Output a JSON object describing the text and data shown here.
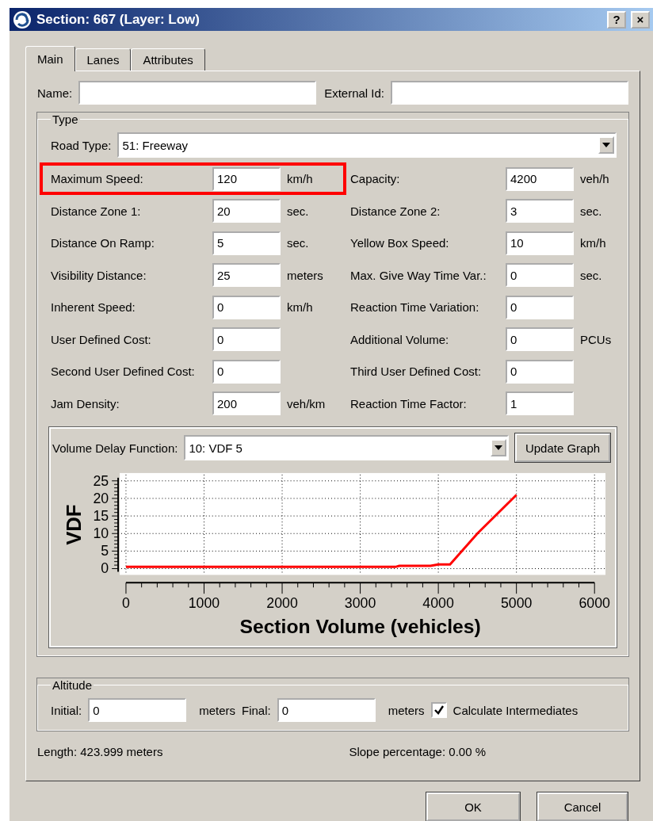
{
  "window": {
    "title": "Section: 667 (Layer: Low)",
    "buttons": [
      "?",
      "×"
    ]
  },
  "tabs": [
    {
      "label": "Main",
      "selected": true
    },
    {
      "label": "Lanes",
      "selected": false
    },
    {
      "label": "Attributes",
      "selected": false
    }
  ],
  "name_field": {
    "label": "Name:"
  },
  "external_id_field": {
    "label": "External Id:"
  },
  "type_group": {
    "title": "Type",
    "road_type": {
      "label": "Road Type:",
      "value": "51: Freeway"
    },
    "rows": [
      {
        "left": {
          "label": "Maximum Speed:",
          "value": "120",
          "unit": "km/h",
          "highlighted": true
        },
        "right": {
          "label": "Capacity:",
          "value": "4200",
          "unit": "veh/h"
        }
      },
      {
        "left": {
          "label": "Distance Zone 1:",
          "value": "20",
          "unit": "sec."
        },
        "right": {
          "label": "Distance Zone 2:",
          "value": "3",
          "unit": "sec."
        }
      },
      {
        "left": {
          "label": "Distance On Ramp:",
          "value": "5",
          "unit": "sec."
        },
        "right": {
          "label": "Yellow Box Speed:",
          "value": "10",
          "unit": "km/h"
        }
      },
      {
        "left": {
          "label": "Visibility Distance:",
          "value": "25",
          "unit": "meters"
        },
        "right": {
          "label": "Max. Give Way Time Var.:",
          "value": "0",
          "unit": "sec."
        }
      },
      {
        "left": {
          "label": "Inherent Speed:",
          "value": "0",
          "unit": "km/h"
        },
        "right": {
          "label": "Reaction Time Variation:",
          "value": "0"
        }
      },
      {
        "left": {
          "label": "User Defined Cost:",
          "value": "0"
        },
        "right": {
          "label": "Additional Volume:",
          "value": "0",
          "unit": "PCUs"
        }
      },
      {
        "left": {
          "label": "Second User Defined Cost:",
          "value": "0"
        },
        "right": {
          "label": "Third User Defined Cost:",
          "value": "0"
        }
      },
      {
        "left": {
          "label": "Jam Density:",
          "value": "200",
          "unit": "veh/km"
        },
        "right": {
          "label": "Reaction Time Factor:",
          "value": "1"
        }
      }
    ],
    "vdf": {
      "label": "Volume Delay Function:",
      "value": "10: VDF 5",
      "button": "Update Graph",
      "chart_data": {
        "type": "line",
        "xlabel": "Section Volume (vehicles)",
        "ylabel": "VDF",
        "xlim": [
          0,
          6000
        ],
        "ylim": [
          0,
          25
        ],
        "xticks": [
          0,
          1000,
          2000,
          3000,
          4000,
          5000,
          6000
        ],
        "yticks": [
          0,
          5,
          10,
          15,
          20,
          25
        ],
        "grid": true,
        "x": [
          0,
          3450,
          3500,
          3900,
          4000,
          4150,
          4500,
          5000
        ],
        "series": [
          {
            "color": "#ff0000",
            "values": [
              0.5,
              0.5,
              0.8,
              0.8,
              1.2,
              1.2,
              10,
              21
            ]
          }
        ]
      }
    }
  },
  "altitude_group": {
    "title": "Altitude",
    "initial": {
      "label": "Initial:",
      "value": "0",
      "unit": "meters"
    },
    "final": {
      "label": "Final:",
      "value": "0",
      "unit": "meters"
    },
    "calculate_intermediates": {
      "label": "Calculate Intermediates",
      "checked": true
    }
  },
  "length": "Length: 423.999 meters",
  "slope": "Slope percentage: 0.00 %",
  "buttons": [
    "OK",
    "Cancel"
  ]
}
